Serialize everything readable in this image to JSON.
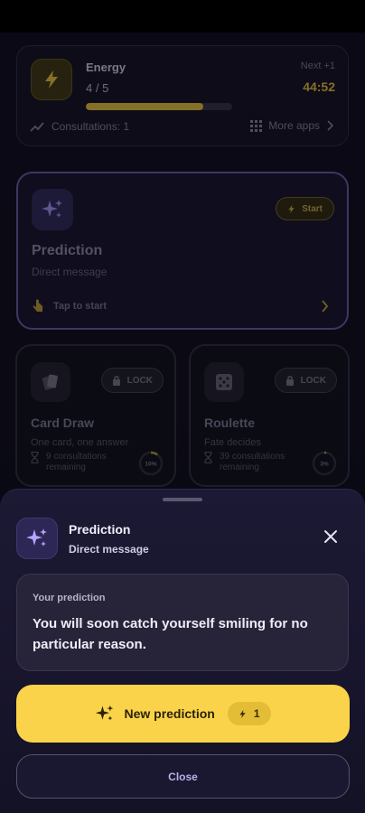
{
  "energy": {
    "title": "Energy",
    "count": "4 / 5",
    "level": 0.8,
    "next_label": "Next +1",
    "timer": "44:52",
    "consultations": "Consultations: 1",
    "more_apps": "More apps"
  },
  "prediction_card": {
    "title": "Prediction",
    "subtitle": "Direct message",
    "start_label": "Start",
    "tap_label": "Tap to start"
  },
  "card_draw": {
    "title": "Card Draw",
    "subtitle": "One card, one answer",
    "lock_label": "LOCK",
    "remaining": "9 consultations remaining",
    "progress_label": "10%",
    "progress": 0.1
  },
  "roulette": {
    "title": "Roulette",
    "subtitle": "Fate decides",
    "lock_label": "LOCK",
    "remaining": "39 consultations remaining",
    "progress_label": "3%",
    "progress": 0.03
  },
  "sheet": {
    "title": "Prediction",
    "subtitle": "Direct message",
    "result_label": "Your prediction",
    "result_text": "You will soon catch yourself smiling for no particular reason.",
    "new_prediction_label": "New prediction",
    "cost": "1",
    "close_label": "Close"
  },
  "colors": {
    "accent_gold": "#fbd34a",
    "accent_purple": "#a78bfa",
    "background": "#0b0a16"
  }
}
